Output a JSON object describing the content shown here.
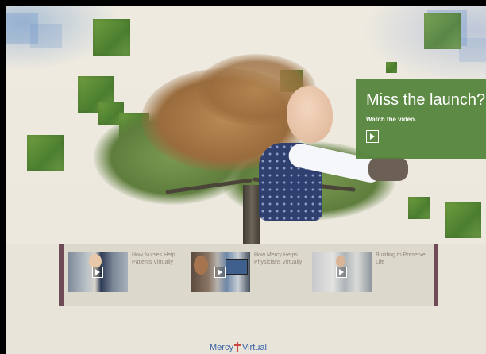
{
  "promo": {
    "title": "Miss the launch?",
    "subtitle": "Watch the video.",
    "play_icon": "play-icon"
  },
  "videos": [
    {
      "title": "How Nurses Help Patients Virtually",
      "play_icon": "play-icon"
    },
    {
      "title": "How Mercy Helps Physicians Virtually",
      "play_icon": "play-icon"
    },
    {
      "title": "Building to Preserve Life",
      "play_icon": "play-icon"
    }
  ],
  "logo": {
    "part1": "Mercy",
    "part2": "Virtual",
    "mark": "cross-icon"
  },
  "colors": {
    "promo_green": "#54843a",
    "video_bar_border": "#6e4b56",
    "logo_blue": "#3a64a6",
    "logo_cross": "#c9453f",
    "background": "#efebe2"
  }
}
